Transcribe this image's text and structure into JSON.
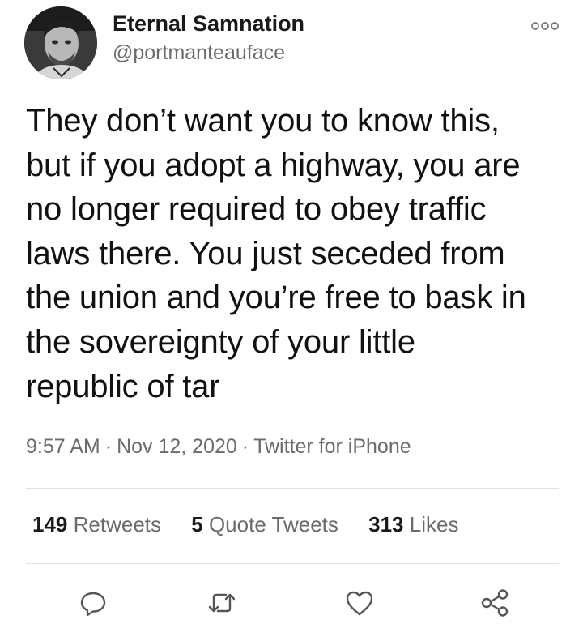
{
  "author": {
    "display_name": "Eternal Samnation",
    "handle": "@portmanteauface",
    "avatar_icon": "profile-photo"
  },
  "tweet": {
    "text": "They don’t want you to know this,\nbut if you adopt a highway, you are\nno longer required to obey traffic\nlaws there. You just seceded from\nthe union and you’re free to bask in\nthe sovereignty of your little\nrepublic of tar",
    "time": "9:57 AM",
    "date": "Nov 12, 2020",
    "separator": "·",
    "source": "Twitter for iPhone"
  },
  "stats": {
    "retweets_count": "149",
    "retweets_label": "Retweets",
    "quotes_count": "5",
    "quotes_label": "Quote Tweets",
    "likes_count": "313",
    "likes_label": "Likes"
  },
  "icons": {
    "more": "more-options-icon",
    "reply": "reply-icon",
    "retweet": "retweet-icon",
    "like": "like-icon",
    "share": "share-icon"
  },
  "colors": {
    "text": "#111111",
    "secondary_text": "#6b6b6b",
    "divider": "#e2e2e2",
    "icon": "#555555"
  }
}
